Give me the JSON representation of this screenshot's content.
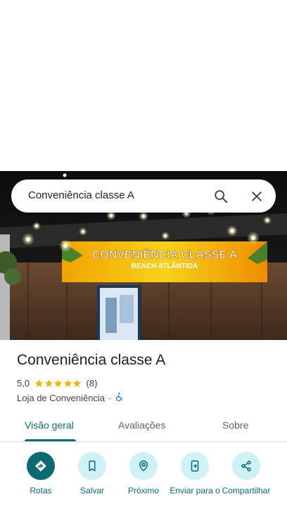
{
  "search": {
    "query": "Conveniência classe A"
  },
  "hero": {
    "sign_title": "CONVENIÊNCIA CLASSE A",
    "sign_subtitle": "BEACH ATLÂNTIDA"
  },
  "place": {
    "name": "Conveniência classe A",
    "rating": "5,0",
    "review_count": "(8)",
    "stars": 5,
    "category": "Loja de Conveniência",
    "separator": "·"
  },
  "tabs": [
    {
      "label": "Visão geral",
      "active": true
    },
    {
      "label": "Avaliações",
      "active": false
    },
    {
      "label": "Sobre",
      "active": false
    }
  ],
  "actions": [
    {
      "label": "Rotas",
      "icon": "directions-icon"
    },
    {
      "label": "Salvar",
      "icon": "bookmark-icon"
    },
    {
      "label": "Próximo",
      "icon": "nearby-icon"
    },
    {
      "label": "Enviar para o",
      "icon": "send-to-phone-icon"
    },
    {
      "label": "Compartilhar",
      "icon": "share-icon"
    }
  ],
  "colors": {
    "accent": "#0b6a72",
    "action_bg": "#cff2f7",
    "star": "#f4b400"
  }
}
